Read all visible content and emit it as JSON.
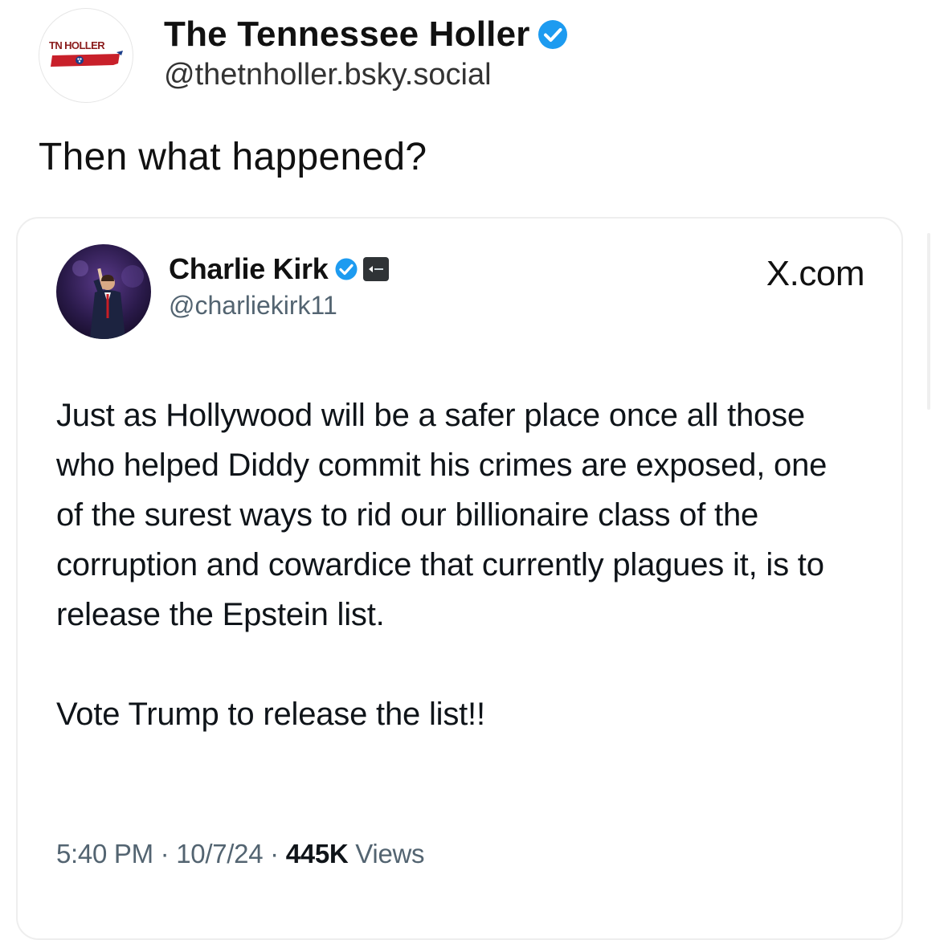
{
  "post": {
    "author_name": "The Tennessee Holler",
    "author_handle": "@thetnholler.bsky.social",
    "avatar_logo_text": "TN HOLLER",
    "text": "Then what happened?"
  },
  "embed": {
    "author_name": "Charlie Kirk",
    "author_handle": "@charliekirk11",
    "source_label": "X.com",
    "paragraphs": [
      "Just as Hollywood will be a safer place once all those who helped Diddy commit his crimes are exposed, one of the surest ways to rid our billionaire class of the corruption and cowardice that currently plagues it, is to release the Epstein list.",
      "Vote Trump to release the list!!"
    ],
    "time": "5:40 PM",
    "date": "10/7/24",
    "views_count": "445K",
    "views_label": "Views",
    "separator": "·"
  },
  "icons": {
    "verified": "verified-check-icon",
    "affiliate": "affiliate-badge-icon"
  },
  "colors": {
    "verified_blue": "#1d9bf0",
    "logo_red": "#c8202a",
    "muted_text": "#536471"
  }
}
